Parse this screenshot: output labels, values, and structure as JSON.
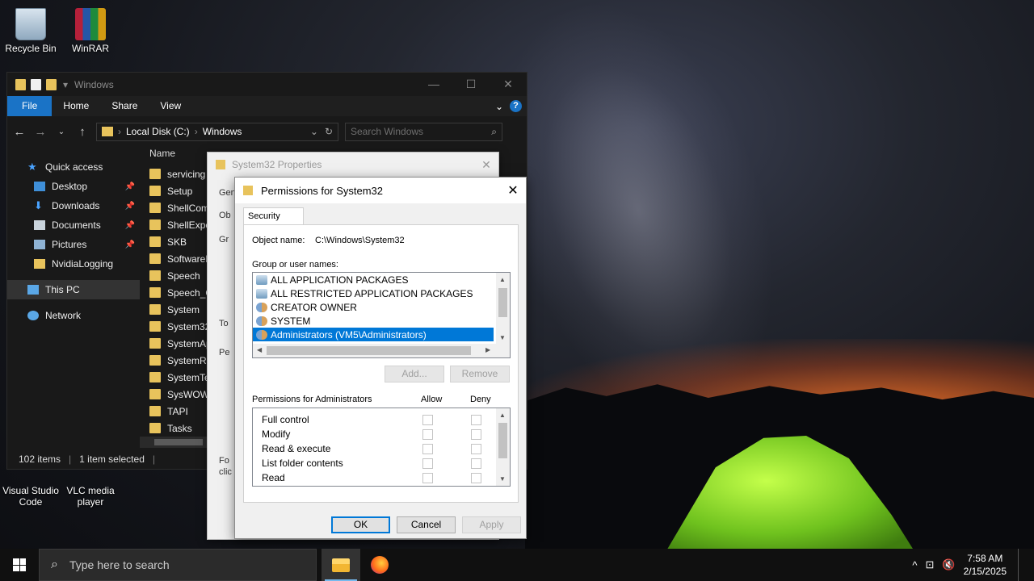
{
  "desktop": {
    "icons": [
      {
        "label": "Recycle Bin"
      },
      {
        "label": "WinRAR"
      },
      {
        "label": "Visual Studio Code"
      },
      {
        "label": "VLC media player"
      }
    ]
  },
  "explorer": {
    "title": "Windows",
    "ribbon": {
      "file": "File",
      "home": "Home",
      "share": "Share",
      "view": "View"
    },
    "address": {
      "root": "Local Disk (C:)",
      "folder": "Windows"
    },
    "search_placeholder": "Search Windows",
    "column_name": "Name",
    "nav": [
      {
        "label": "Quick access"
      },
      {
        "label": "Desktop"
      },
      {
        "label": "Downloads"
      },
      {
        "label": "Documents"
      },
      {
        "label": "Pictures"
      },
      {
        "label": "NvidiaLogging"
      },
      {
        "label": "This PC"
      },
      {
        "label": "Network"
      }
    ],
    "files": [
      "servicing",
      "Setup",
      "ShellCom",
      "ShellExpe",
      "SKB",
      "SoftwareD",
      "Speech",
      "Speech_O",
      "System",
      "System32",
      "SystemAp",
      "SystemRe",
      "SystemTe",
      "SysWOW",
      "TAPI",
      "Tasks"
    ],
    "status": {
      "items": "102 items",
      "selected": "1 item selected"
    }
  },
  "props": {
    "title": "System32 Properties",
    "fragments": [
      "Gen",
      "Ob",
      "Gr",
      "To",
      "Pe",
      "Fo",
      "clic"
    ]
  },
  "perm": {
    "title": "Permissions for System32",
    "tab": "Security",
    "object_label": "Object name:",
    "object_value": "C:\\Windows\\System32",
    "group_label": "Group or user names:",
    "groups": [
      {
        "name": "ALL APPLICATION PACKAGES",
        "icon": "package-icon"
      },
      {
        "name": "ALL RESTRICTED APPLICATION PACKAGES",
        "icon": "package-icon"
      },
      {
        "name": "CREATOR OWNER",
        "icon": "users-icon"
      },
      {
        "name": "SYSTEM",
        "icon": "users-icon"
      },
      {
        "name": "Administrators (VM5\\Administrators)",
        "icon": "users-icon"
      }
    ],
    "add": "Add...",
    "remove": "Remove",
    "perms_label": "Permissions for Administrators",
    "allow": "Allow",
    "deny": "Deny",
    "permissions": [
      "Full control",
      "Modify",
      "Read & execute",
      "List folder contents",
      "Read"
    ],
    "ok": "OK",
    "cancel": "Cancel",
    "apply": "Apply"
  },
  "taskbar": {
    "search_placeholder": "Type here to search",
    "time": "7:58 AM",
    "date": "2/15/2025"
  }
}
